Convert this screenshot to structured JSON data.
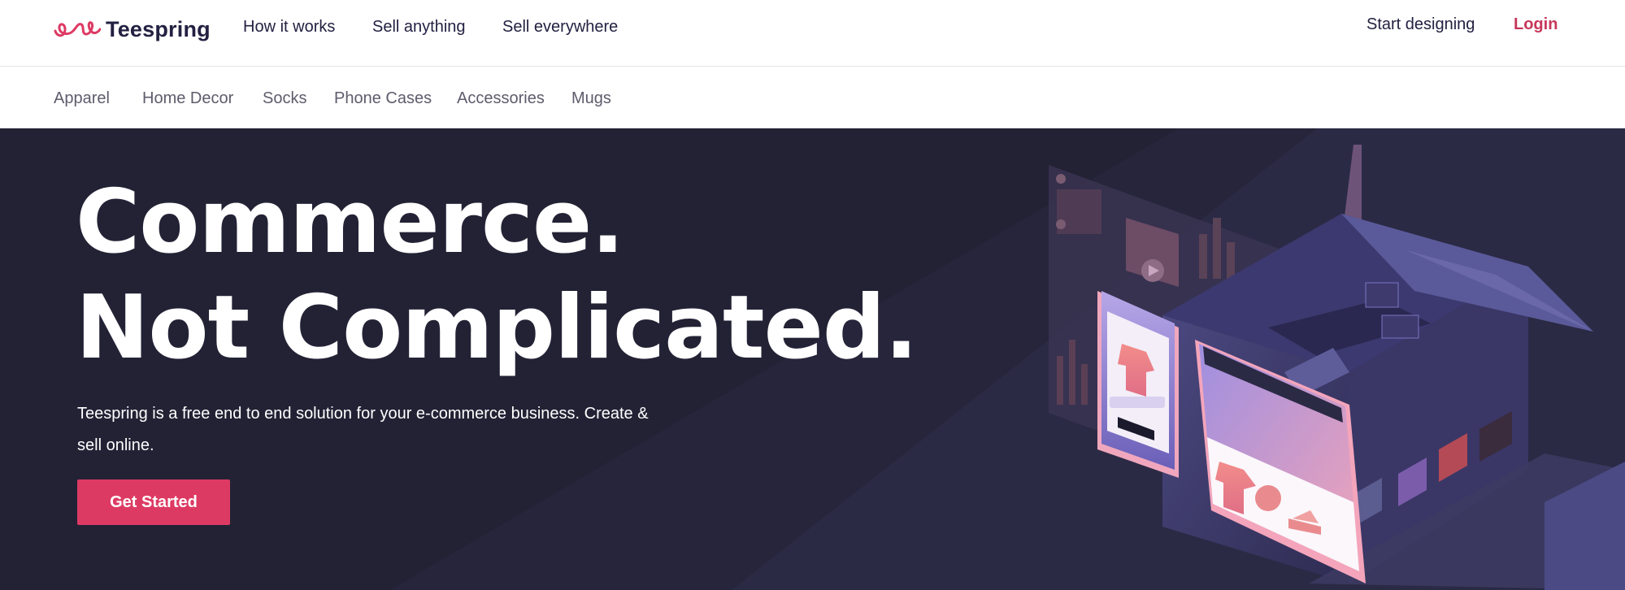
{
  "brand": {
    "name": "Teespring",
    "accent": "#dd3a63",
    "navy": "#232142"
  },
  "topnav": {
    "links": [
      {
        "label": "How it works"
      },
      {
        "label": "Sell anything"
      },
      {
        "label": "Sell everywhere"
      }
    ],
    "start_designing": "Start designing",
    "login": "Login"
  },
  "categories": [
    "Apparel",
    "Home Decor",
    "Socks",
    "Phone Cases",
    "Accessories",
    "Mugs"
  ],
  "hero": {
    "headline_line1": "Commerce.",
    "headline_line2": "Not Complicated.",
    "subtitle": "Teespring is a free end to end solution for your e-commerce business. Create & sell online.",
    "cta_label": "Get Started",
    "background": "#232235"
  }
}
